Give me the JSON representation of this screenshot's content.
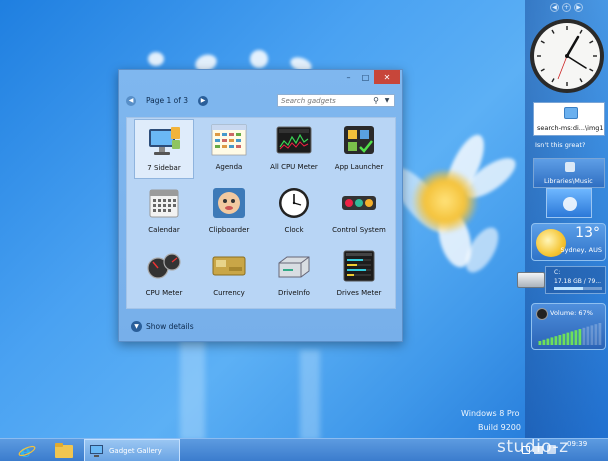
{
  "window": {
    "page_indicator": "Page 1 of 3",
    "search_placeholder": "Search gadgets",
    "show_details": "Show details"
  },
  "gadgets": [
    {
      "label": "7 Sidebar",
      "icon": "monitor-icon",
      "selected": true
    },
    {
      "label": "Agenda",
      "icon": "agenda-icon",
      "selected": false
    },
    {
      "label": "All CPU Meter",
      "icon": "cpu-graph-icon",
      "selected": false
    },
    {
      "label": "App Launcher",
      "icon": "app-launcher-icon",
      "selected": false
    },
    {
      "label": "Calendar",
      "icon": "calendar-icon",
      "selected": false
    },
    {
      "label": "Clipboarder",
      "icon": "clipboarder-icon",
      "selected": false
    },
    {
      "label": "Clock",
      "icon": "clock-icon",
      "selected": false
    },
    {
      "label": "Control System",
      "icon": "control-system-icon",
      "selected": false
    },
    {
      "label": "CPU Meter",
      "icon": "cpu-meter-icon",
      "selected": false
    },
    {
      "label": "Currency",
      "icon": "currency-icon",
      "selected": false
    },
    {
      "label": "DriveInfo",
      "icon": "drive-icon",
      "selected": false
    },
    {
      "label": "Drives Meter",
      "icon": "drives-meter-icon",
      "selected": false
    }
  ],
  "sidebar": {
    "slideshow_path": "search-ms:di...\\img1",
    "slideshow_caption": "Isn't this great?",
    "slideshow_library": "Libraries\\Music",
    "weather_temp": "13°",
    "weather_city": "Sydney, AUS",
    "drive_letter": "C:",
    "drive_free": "17.18 GB / 79...",
    "drive_used_fraction": 0.6,
    "volume_label": "Volume: 67%",
    "volume_fraction": 0.67
  },
  "watermark": {
    "edition": "Windows 8 Pro",
    "build": "Build 9200"
  },
  "taskbar": {
    "active_window": "Gadget Gallery",
    "time": "09:39",
    "brand": "studio-z"
  },
  "colors": {
    "desktop": "#3f98ea",
    "close_button": "#c7463a",
    "taskbar": "#3b7ccd"
  }
}
